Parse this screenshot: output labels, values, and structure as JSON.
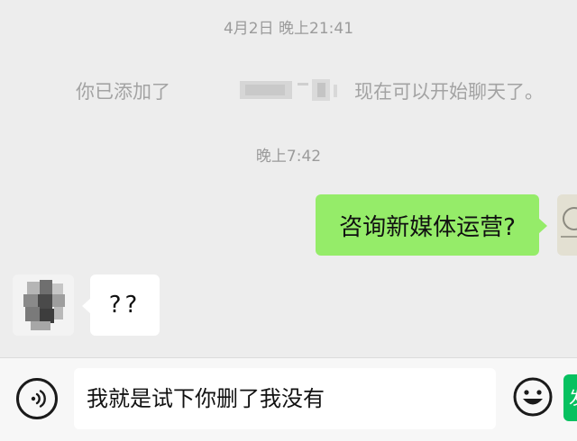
{
  "chat": {
    "timestamp_1": "4月2日 晚上21:41",
    "system_message": {
      "prefix": "你已添加了",
      "suffix": "现在可以开始聊天了。"
    },
    "timestamp_2": "晚上7:42",
    "messages": [
      {
        "side": "right",
        "text": "咨询新媒体运营?"
      },
      {
        "side": "left",
        "text": "??"
      }
    ]
  },
  "input_bar": {
    "text_value": "我就是试下你删了我没有",
    "send_label": "发送"
  },
  "colors": {
    "background": "#ededed",
    "outgoing_bubble": "#95ec69",
    "incoming_bubble": "#ffffff",
    "send_button": "#07c160",
    "timestamp_text": "#9b9b9b"
  },
  "icons": [
    "voice-icon",
    "emoji-icon"
  ]
}
